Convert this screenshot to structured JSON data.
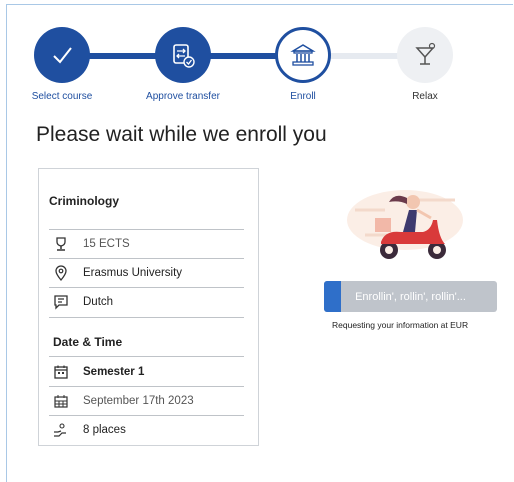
{
  "steps": [
    {
      "label": "Select course",
      "state": "done",
      "icon": "check-icon"
    },
    {
      "label": "Approve transfer",
      "state": "done",
      "icon": "transfer-approve-icon"
    },
    {
      "label": "Enroll",
      "state": "current",
      "icon": "bank-building-icon"
    },
    {
      "label": "Relax",
      "state": "todo",
      "icon": "cocktail-icon"
    }
  ],
  "heading": "Please wait while we enroll you",
  "course": {
    "title": "Criminology",
    "credits": "15 ECTS",
    "university": "Erasmus University",
    "language": "Dutch"
  },
  "datetime": {
    "title": "Date & Time",
    "semester": "Semester 1",
    "date": "September 17th 2023",
    "places": "8 places"
  },
  "progress": {
    "text": "Enrollin', rollin', rollin'...",
    "fraction": 0.1
  },
  "request": {
    "text": "Requesting your information at",
    "org": "EUR"
  },
  "colors": {
    "primary": "#1f4fa0",
    "progress_fill": "#2f6fc9",
    "progress_track": "#bfc4cb",
    "frame_border": "#a9c8e6"
  }
}
